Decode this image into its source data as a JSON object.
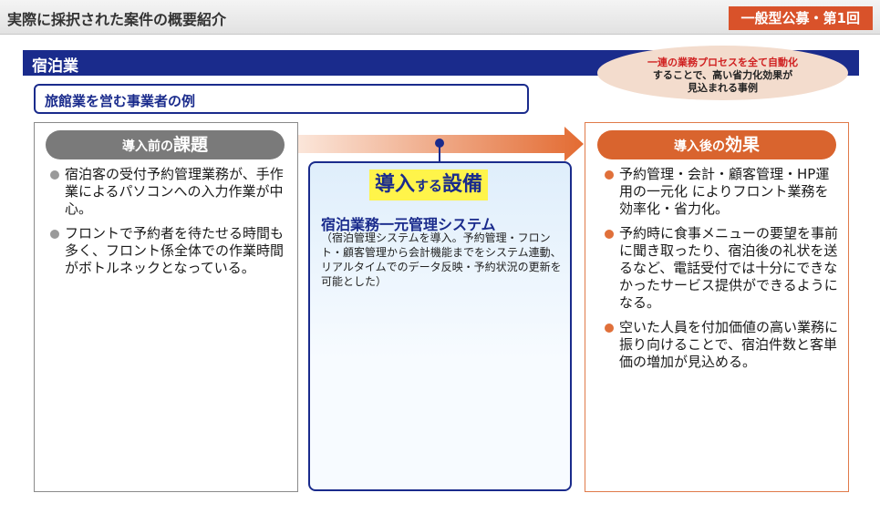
{
  "header": {
    "title": "実際に採択された案件の概要紹介",
    "tag": "一般型公募・第1回"
  },
  "section": {
    "title": "宿泊業"
  },
  "callout": {
    "line1": "一連の業務プロセスを全て自動化",
    "line2": "することで、高い省力化効果が",
    "line3": "見込まれる事例"
  },
  "example": {
    "label": "旅館業を営む事業者の例"
  },
  "before": {
    "heading_small": "導入前の",
    "heading_big": "課題",
    "items": [
      "宿泊客の受付予約管理業務が、手作業によるパソコンへの入力作業が中心。",
      "フロントで予約者を待たせる時間も多く、フロント係全体での作業時間がボトルネックとなっている。"
    ]
  },
  "equipment": {
    "heading_big1": "導入",
    "heading_small": "する",
    "heading_big2": "設備",
    "name": "宿泊業務一元管理システム",
    "description": "（宿泊管理システムを導入。予約管理・フロント・顧客管理から会計機能までをシステム連動、リアルタイムでのデータ反映・予約状況の更新を可能とした）"
  },
  "after": {
    "heading_small": "導入後の",
    "heading_big": "効果",
    "items": [
      "予約管理・会計・顧客管理・HP運用の一元化 によりフロント業務を効率化・省力化。",
      "予約時に食事メニューの要望を事前に聞き取ったり、宿泊後の礼状を送るなど、電話受付では十分にできなかったサービス提供ができるようになる。",
      "空いた人員を付加価値の高い業務に振り向けることで、宿泊件数と客単価の増加が見込める。"
    ]
  },
  "colors": {
    "navy": "#1a2b8c",
    "orange": "#d9642e",
    "gray": "#7a7a7a",
    "highlight": "#fff44a"
  }
}
